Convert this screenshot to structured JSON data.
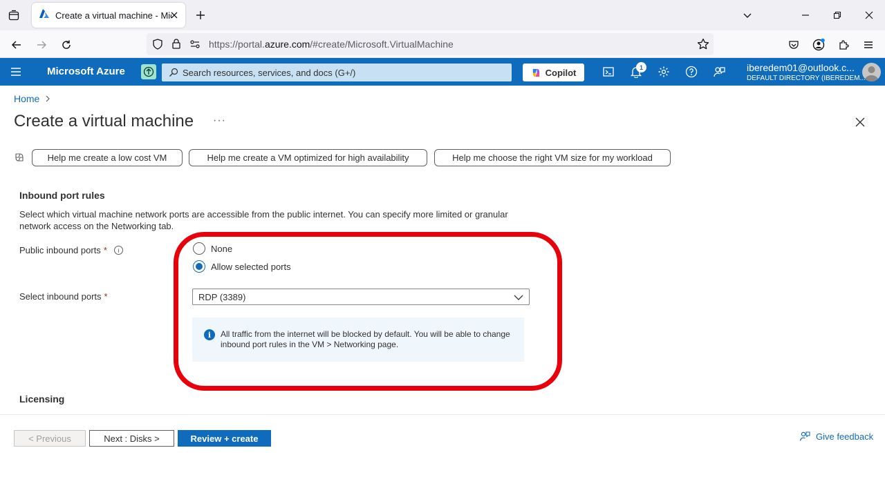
{
  "browser": {
    "tab_title": "Create a virtual machine - Micr",
    "url_prefix": "https://portal.",
    "url_host": "azure.com",
    "url_path": "/#create/Microsoft.VirtualMachine"
  },
  "azure_header": {
    "brand": "Microsoft Azure",
    "search_placeholder": "Search resources, services, and docs (G+/)",
    "copilot_label": "Copilot",
    "notification_count": "1",
    "account_email": "iberedem01@outlook.c...",
    "account_directory": "DEFAULT DIRECTORY (IBEREDEM..."
  },
  "breadcrumb": {
    "home": "Home"
  },
  "page": {
    "title": "Create a virtual machine",
    "more": "···"
  },
  "help_buttons": [
    {
      "label": "Help me create a low cost VM"
    },
    {
      "label": "Help me create a VM optimized for high availability"
    },
    {
      "label": "Help me choose the right VM size for my workload"
    }
  ],
  "inbound": {
    "section_title": "Inbound port rules",
    "description": "Select which virtual machine network ports are accessible from the public internet. You can specify more limited or granular network access on the Networking tab.",
    "public_ports_label": "Public inbound ports",
    "required_mark": "*",
    "info_mark": "i",
    "options": [
      {
        "label": "None",
        "selected": false
      },
      {
        "label": "Allow selected ports",
        "selected": true
      }
    ],
    "select_ports_label": "Select inbound ports",
    "selected_ports": "RDP (3389)",
    "info_message": "All traffic from the internet will be blocked by default. You will be able to change inbound port rules in the VM > Networking page."
  },
  "licensing": {
    "section_title": "Licensing"
  },
  "footer": {
    "previous": "< Previous",
    "next": "Next : Disks >",
    "review": "Review + create",
    "feedback": "Give feedback"
  },
  "colors": {
    "azure_blue": "#0f6cbd",
    "highlight_red": "#e8000b"
  }
}
